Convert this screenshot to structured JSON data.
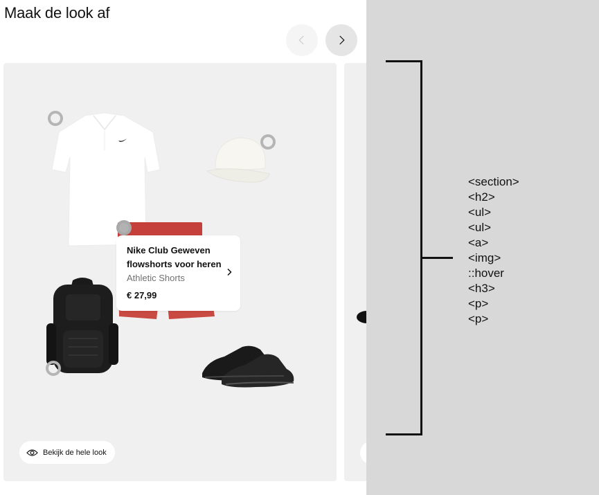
{
  "section": {
    "title": "Maak de look af"
  },
  "carousel": {
    "prev_icon": "chevron-left-icon",
    "next_icon": "chevron-right-icon"
  },
  "look": {
    "hotspot_icon": "circle-icon",
    "tooltip": {
      "name": "Nike Club Geweven flowshorts voor heren",
      "category": "Athletic Shorts",
      "price": "€ 27,99",
      "chevron_icon": "chevron-right-icon"
    },
    "view_button": {
      "label": "Bekijk de hele look",
      "icon": "eye-icon"
    }
  },
  "annotation": {
    "tags": [
      "<section>",
      "<h2>",
      "<ul>",
      "<ul>",
      "<a>",
      "<img>",
      "::hover",
      "<h3>",
      "<p>",
      "<p>"
    ]
  }
}
